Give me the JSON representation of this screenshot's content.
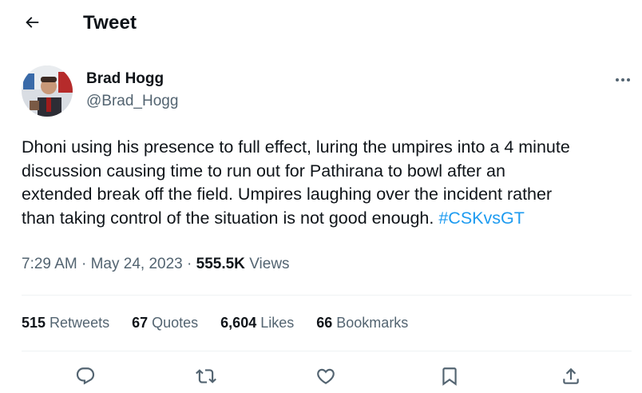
{
  "header": {
    "back_icon": "arrow-left-icon",
    "title": "Tweet"
  },
  "author": {
    "name": "Brad Hogg",
    "handle": "@Brad_Hogg",
    "more_icon": "more-horizontal-icon"
  },
  "tweet": {
    "lines": [
      "Dhoni using his presence to full effect, luring the umpires into a 4 minute",
      "discussion causing time to run out for Pathirana to bowl after an",
      "extended break off the field. Umpires laughing over the incident rather",
      "than taking control of the situation is not good enough. "
    ],
    "hashtag": "#CSKvsGT"
  },
  "meta": {
    "time": "7:29 AM",
    "separator": " · ",
    "date": "May 24, 2023",
    "views_count": "555.5K",
    "views_label": " Views"
  },
  "stats": [
    {
      "count": "515",
      "label": " Retweets"
    },
    {
      "count": "67",
      "label": " Quotes"
    },
    {
      "count": "6,604",
      "label": " Likes"
    },
    {
      "count": "66",
      "label": " Bookmarks"
    }
  ],
  "actions": [
    "reply-icon",
    "retweet-icon",
    "like-icon",
    "bookmark-icon",
    "share-icon"
  ],
  "colors": {
    "text_primary": "#0f1419",
    "text_secondary": "#536471",
    "accent": "#1d9bf0",
    "divider": "#eff3f4"
  }
}
